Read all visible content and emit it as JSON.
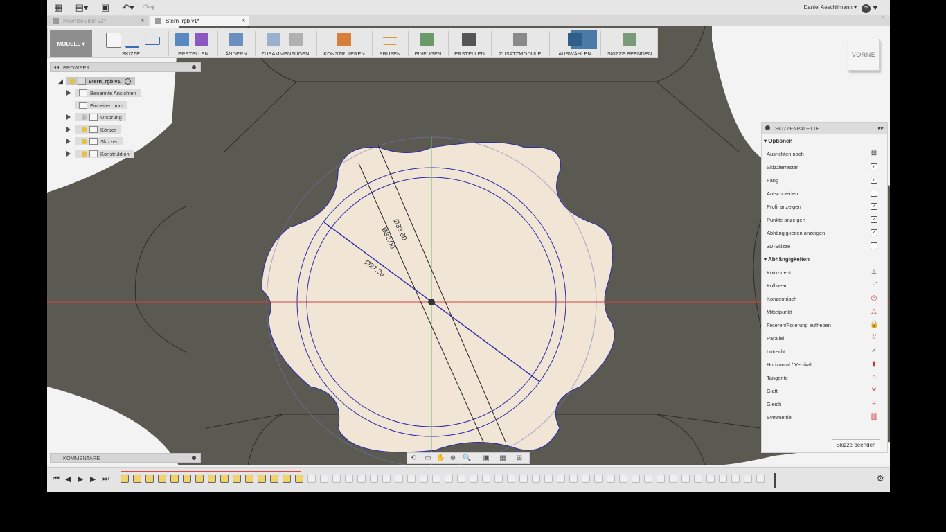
{
  "topbar": {
    "user_name": "Daniel Aeschlimann",
    "help_label": "?"
  },
  "tabs": [
    {
      "label": "KnorrBouillon v2*",
      "active": false
    },
    {
      "label": "Stern_rgb v1*",
      "active": true
    }
  ],
  "ribbon": {
    "workspace": "MODELL",
    "groups": [
      "SKIZZE",
      "ERSTELLEN",
      "ÄNDERN",
      "ZUSAMMENFÜGEN",
      "KONSTRUIEREN",
      "PRÜFEN",
      "EINFÜGEN",
      "ERSTELLEN",
      "ZUSATZMODULE",
      "AUSWÄHLEN",
      "SKIZZE BEENDEN"
    ]
  },
  "browser": {
    "title": "BROWSER",
    "root": "Stern_rgb v1",
    "items": [
      "Benannte Ansichten",
      "Einheiten: mm",
      "Ursprung",
      "Körper",
      "Skizzen",
      "Konstruktion"
    ]
  },
  "comments": {
    "title": "KOMMENTARE"
  },
  "viewcube": {
    "label": "VORNE"
  },
  "dimensions": {
    "d1": "Ø33.60",
    "d2": "Ø32.00",
    "d3": "Ø27.20"
  },
  "palette": {
    "title": "SKIZZENPALETTE",
    "options_title": "Optionen",
    "options": [
      {
        "label": "Ausrichten nach",
        "type": "icon",
        "icon": "align-icon"
      },
      {
        "label": "Skizzierraster",
        "type": "check",
        "checked": true
      },
      {
        "label": "Fang",
        "type": "check",
        "checked": true
      },
      {
        "label": "Aufschneiden",
        "type": "check",
        "checked": false
      },
      {
        "label": "Profil anzeigen",
        "type": "check",
        "checked": true
      },
      {
        "label": "Punkte anzeigen",
        "type": "check",
        "checked": true
      },
      {
        "label": "Abhängigkeiten anzeigen",
        "type": "check",
        "checked": true
      },
      {
        "label": "3D-Skizze",
        "type": "check",
        "checked": false
      }
    ],
    "constraints_title": "Abhängigkeiten",
    "constraints": [
      {
        "label": "Koinzident",
        "glyph": "⊥",
        "color": "#666666"
      },
      {
        "label": "Kollinear",
        "glyph": "⋰",
        "color": "#666666"
      },
      {
        "label": "Konzentrisch",
        "glyph": "◎",
        "color": "#cc3333"
      },
      {
        "label": "Mittelpunkt",
        "glyph": "△",
        "color": "#cc3333"
      },
      {
        "label": "Fixieren/Fixierung aufheben",
        "glyph": "🔒",
        "color": "#cc3333"
      },
      {
        "label": "Parallel",
        "glyph": "//",
        "color": "#cc3333"
      },
      {
        "label": "Lotrecht",
        "glyph": "✓",
        "color": "#666666"
      },
      {
        "label": "Horizontal / Vertikal",
        "glyph": "▮",
        "color": "#cc3333"
      },
      {
        "label": "Tangente",
        "glyph": "○",
        "color": "#cc3333"
      },
      {
        "label": "Glatt",
        "glyph": "✕",
        "color": "#cc3333"
      },
      {
        "label": "Gleich",
        "glyph": "=",
        "color": "#cc3333"
      },
      {
        "label": "Symmetrie",
        "glyph": "[|]",
        "color": "#cc3333"
      }
    ],
    "finish_label": "Skizze beenden"
  },
  "colors": {
    "solid": "#5b5a52",
    "profile": "#f1e5d6",
    "sketch_line": "#2a2aa8",
    "axis_x": "#cc4444",
    "axis_y": "#66bb66"
  }
}
